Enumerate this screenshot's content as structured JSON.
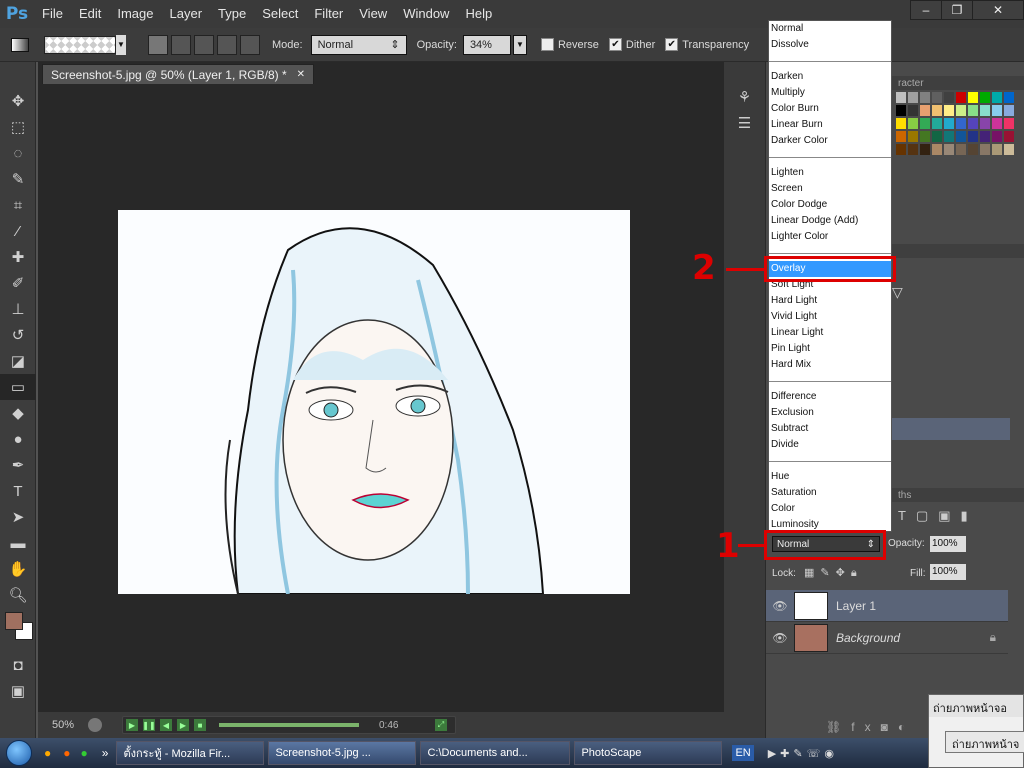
{
  "app": {
    "logo": "Ps"
  },
  "menu": [
    "File",
    "Edit",
    "Image",
    "Layer",
    "Type",
    "Select",
    "Filter",
    "View",
    "Window",
    "Help"
  ],
  "window_controls": [
    "–",
    "❐",
    "✕"
  ],
  "options": {
    "mode_label": "Mode:",
    "mode_value": "Normal",
    "opacity_label": "Opacity:",
    "opacity_value": "34%",
    "reverse_label": "Reverse",
    "dither_label": "Dither",
    "transparency_label": "Transparency",
    "reverse_checked": false,
    "dither_checked": true,
    "transparency_checked": true
  },
  "document": {
    "tab_title": "Screenshot-5.jpg @ 50% (Layer 1, RGB/8) *",
    "zoom": "50%",
    "time": "0:46"
  },
  "panels": {
    "swatches_header": "racter",
    "paths_header": "ths"
  },
  "blend_menu": {
    "groups": [
      [
        "Normal",
        "Dissolve"
      ],
      [
        "Darken",
        "Multiply",
        "Color Burn",
        "Linear Burn",
        "Darker Color"
      ],
      [
        "Lighten",
        "Screen",
        "Color Dodge",
        "Linear Dodge (Add)",
        "Lighter Color"
      ],
      [
        "Overlay",
        "Soft Light",
        "Hard Light",
        "Vivid Light",
        "Linear Light",
        "Pin Light",
        "Hard Mix"
      ],
      [
        "Difference",
        "Exclusion",
        "Subtract",
        "Divide"
      ],
      [
        "Hue",
        "Saturation",
        "Color",
        "Luminosity"
      ]
    ],
    "selected": "Overlay"
  },
  "layers": {
    "blend_mode": "Normal",
    "opacity_label": "Opacity:",
    "opacity_value": "100%",
    "lock_label": "Lock:",
    "fill_label": "Fill:",
    "fill_value": "100%",
    "items": [
      {
        "name": "Layer 1",
        "selected": true
      },
      {
        "name": "Background",
        "selected": false
      }
    ]
  },
  "annotations": {
    "step1": "1",
    "step2": "2"
  },
  "taskbar": {
    "tasks": [
      "ตั้งกระทู้ - Mozilla Fir...",
      "Screenshot-5.jpg ...",
      "C:\\Documents and...",
      "PhotoScape"
    ],
    "lang": "EN"
  },
  "popup": {
    "title": "ถ่ายภาพหน้าจอ",
    "button": "ถ่ายภาพหน้าจ"
  },
  "swatch_colors": [
    "#c0c0c0",
    "#a0a0a0",
    "#808080",
    "#606060",
    "#404040",
    "#cc0000",
    "#ffff00",
    "#00aa00",
    "#00aaaa",
    "#0066cc",
    "#000000",
    "#333333",
    "#e8a070",
    "#f0c070",
    "#ffee88",
    "#ccee88",
    "#88dd88",
    "#88ddcc",
    "#88ccee",
    "#88aadd",
    "#ffdd00",
    "#88cc44",
    "#33aa55",
    "#22aa99",
    "#22aacc",
    "#3366cc",
    "#5544bb",
    "#8844aa",
    "#cc3399",
    "#ee3366",
    "#cc6600",
    "#997700",
    "#447722",
    "#116644",
    "#117777",
    "#115599",
    "#223388",
    "#442277",
    "#771166",
    "#991133",
    "#663300",
    "#553311",
    "#332211",
    "#aa8866",
    "#998877",
    "#776655",
    "#554433",
    "#887766",
    "#aa9977",
    "#ccbb99"
  ]
}
